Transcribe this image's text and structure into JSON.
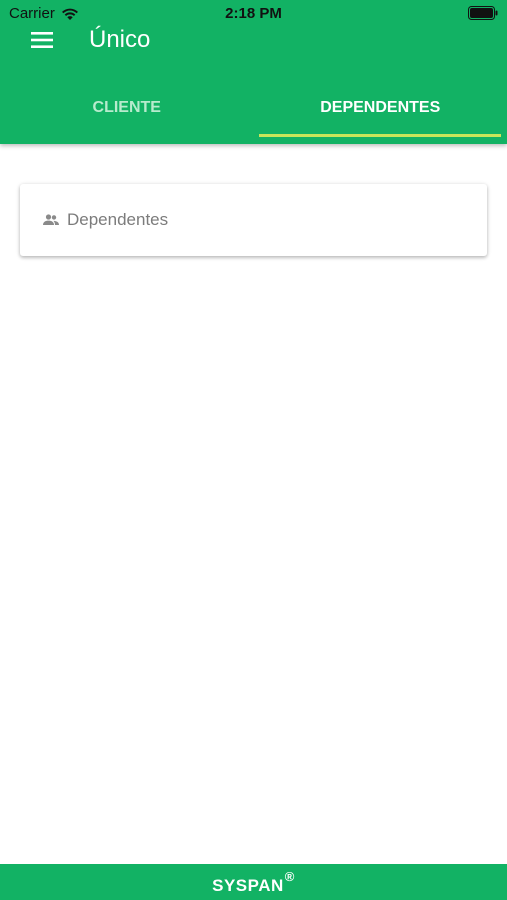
{
  "status_bar": {
    "carrier": "Carrier",
    "time": "2:18 PM",
    "icons": [
      "wifi-icon",
      "battery-icon"
    ]
  },
  "app_bar": {
    "title": "Único",
    "menu_icon": "menu-icon"
  },
  "tabs": [
    {
      "label": "CLIENTE",
      "selected": false
    },
    {
      "label": "DEPENDENTES",
      "selected": true
    }
  ],
  "card": {
    "label": "Dependentes",
    "icon": "people-icon"
  },
  "footer": {
    "brand": "SYSPAN",
    "registered_mark": "®"
  },
  "colors": {
    "primary": "#12b264",
    "tab_indicator": "#c8e65a",
    "inactive_tab_text": "#b7ebcd",
    "card_text": "#7c7c7c"
  }
}
